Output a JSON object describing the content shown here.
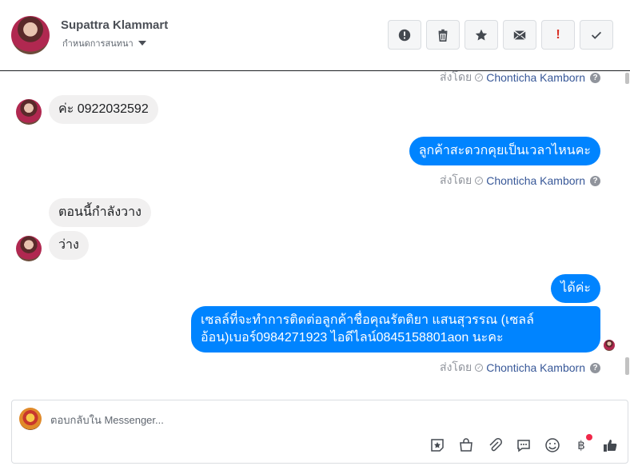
{
  "header": {
    "contact_name": "Supattra Klammart",
    "assign_label": "กำหนดการสนทนา",
    "tools": [
      "report-icon",
      "trash-icon",
      "star-icon",
      "mail-icon",
      "alert-icon",
      "check-icon"
    ],
    "alert_glyph": "!"
  },
  "meta": {
    "sent_by": "ส่งโดย",
    "agent": "Chonticha Kamborn",
    "help": "?"
  },
  "messages": [
    {
      "dir": "in",
      "text": "ค่ะ 0922032592"
    },
    {
      "dir": "out",
      "text": "ลูกค้าสะดวกคุยเป็นเวลาไหนคะ"
    },
    {
      "dir": "in",
      "text": "ตอนนี้กำลังวาง"
    },
    {
      "dir": "in",
      "text": "ว่าง"
    },
    {
      "dir": "out",
      "text": "ได้ค่ะ"
    },
    {
      "dir": "out",
      "text": "เซลล์ที่จะทำการติดต่อลูกค้าชื่อคุณรัตติยา แสนสุวรรณ (เซลล์อ้อน)เบอร์0984271923 ไอดีไลน์0845158801aon นะคะ"
    }
  ],
  "composer": {
    "placeholder": "ตอบกลับใน Messenger...",
    "icons": [
      "sticker-icon",
      "shop-icon",
      "attach-icon",
      "saved-reply-icon",
      "emoji-icon",
      "baht-icon",
      "like-icon"
    ],
    "baht_glyph": "฿"
  },
  "colors": {
    "accent": "#0084ff",
    "incoming": "#f1f0f0",
    "agent_link": "#385898"
  }
}
